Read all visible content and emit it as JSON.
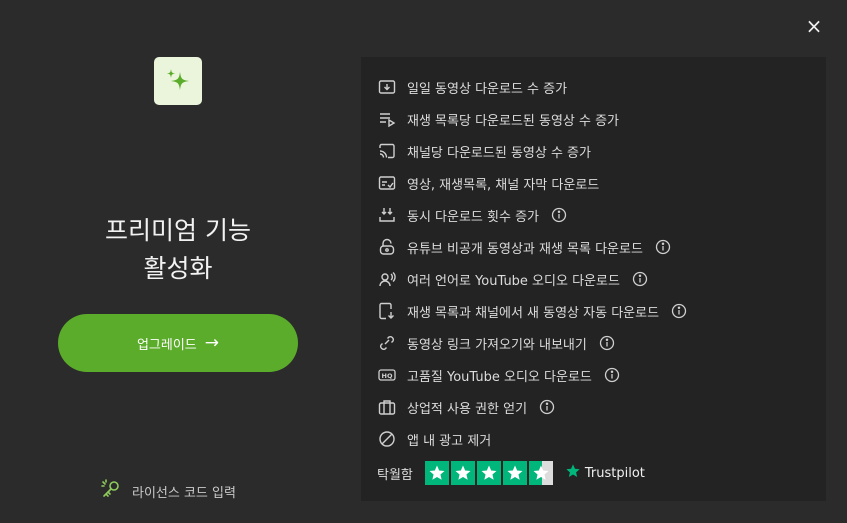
{
  "dialog": {
    "close_label": "×",
    "title_line1": "프리미엄 기능",
    "title_line2": "활성화",
    "upgrade_label": "업그레이드",
    "upgrade_arrow": "→",
    "license_label": "라이선스 코드 입력"
  },
  "features": [
    {
      "icon": "video-download-icon",
      "label": "일일 동영상 다운로드 수 증가",
      "info": false
    },
    {
      "icon": "playlist-icon",
      "label": "재생 목록당 다운로드된 동영상 수 증가",
      "info": false
    },
    {
      "icon": "channel-cast-icon",
      "label": "채널당 다운로드된 동영상 수 증가",
      "info": false
    },
    {
      "icon": "subtitles-icon",
      "label": "영상, 재생목록, 채널 자막 다운로드",
      "info": false
    },
    {
      "icon": "concurrent-download-icon",
      "label": "동시 다운로드 횟수 증가",
      "info": true
    },
    {
      "icon": "unlock-icon",
      "label": "유튜브 비공개 동영상과 재생 목록 다운로드",
      "info": true
    },
    {
      "icon": "voice-language-icon",
      "label": "여러 언어로 YouTube 오디오 다운로드",
      "info": true
    },
    {
      "icon": "auto-download-icon",
      "label": "재생 목록과 채널에서 새 동영상 자동 다운로드",
      "info": true
    },
    {
      "icon": "link-icon",
      "label": "동영상 링크 가져오기와 내보내기",
      "info": true
    },
    {
      "icon": "hq-audio-icon",
      "label": "고품질 YouTube 오디오 다운로드",
      "info": true
    },
    {
      "icon": "briefcase-icon",
      "label": "상업적 사용 권한 얻기",
      "info": true
    },
    {
      "icon": "no-ads-icon",
      "label": "앱 내 광고 제거",
      "info": false
    }
  ],
  "rating": {
    "label": "탁월함",
    "stars": 4.5,
    "brand": "Trustpilot"
  },
  "colors": {
    "background": "#2b2b2b",
    "panel": "#232323",
    "accent": "#5aac2a",
    "trustpilot_green": "#00b67a",
    "logo_bg": "#eaf5dc"
  }
}
